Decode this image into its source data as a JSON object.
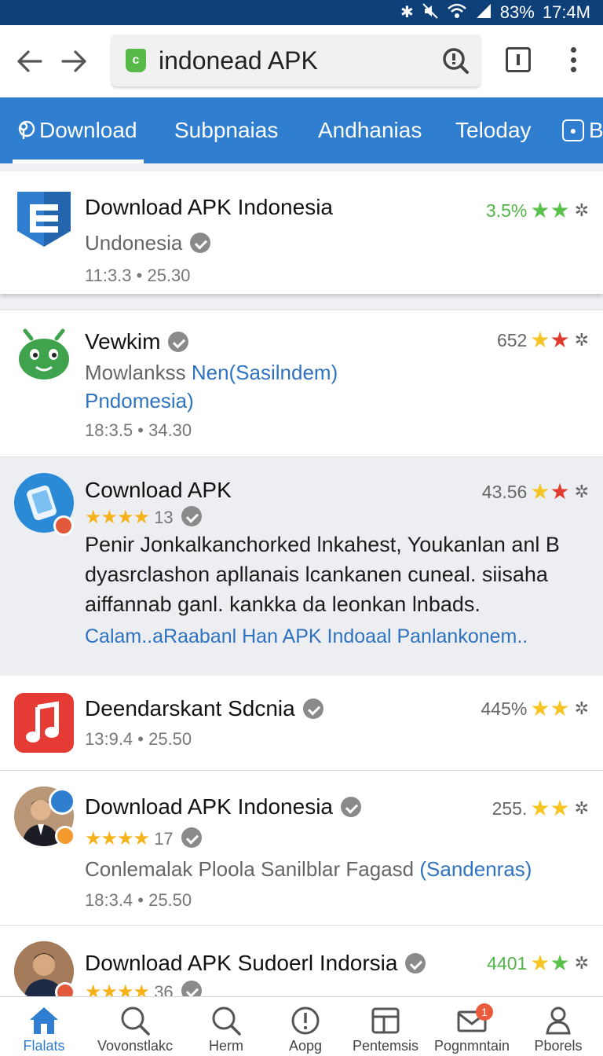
{
  "status_bar": {
    "battery": "83%",
    "time": "17:4M"
  },
  "browser": {
    "url_text": "indonead APK"
  },
  "tabs": [
    {
      "label": "Download"
    },
    {
      "label": "Subpnaias"
    },
    {
      "label": "Andhanias"
    },
    {
      "label": "Teloday"
    },
    {
      "label": "B"
    }
  ],
  "apps": [
    {
      "title": "Download APK Indonesia",
      "subtitle": "Undonesia",
      "meta": "11:3.3  •  25.30",
      "rating": "3.5%",
      "accent_color": "#52b548"
    },
    {
      "title": "Vewkim",
      "subtitle_prefix": "Mowlankss ",
      "subtitle_link": "Nen(Sasilndem)",
      "subtitle_link_line2": "Pndomesia)",
      "meta": "18:3.5  •  34.30",
      "rating": "652"
    },
    {
      "title": "Cownload APK",
      "star_count": "13",
      "rating": "43.56",
      "description": "Penir Jonkalkanchorked lnkahest, Youkanlan anl B dyasrclashon apllanais lcankanen cuneal. siisaha aiffannab ganl. kankka da leonkan lnbads.",
      "link": "Calam..aRaabanl Han APK Indoaal Panlankonem.."
    },
    {
      "title": "Deendarskant Sdcnia",
      "meta": "13:9.4  •  25.50",
      "rating": "445%"
    },
    {
      "title": "Download APK Indonesia",
      "star_count": "17",
      "subtitle_prefix": "Conlemalak Ploola Sanilblar Fagasd ",
      "subtitle_link": "(Sandenras)",
      "meta": "18:3.4  •  25.50",
      "rating": "255."
    },
    {
      "title": "Download APK Sudoerl Indorsia",
      "star_count": "36",
      "rating": "4401"
    }
  ],
  "bottom_nav": [
    {
      "label": "Flalats",
      "icon": "home-icon"
    },
    {
      "label": "Vovonstlakc",
      "icon": "search-icon"
    },
    {
      "label": "Herm",
      "icon": "search-icon"
    },
    {
      "label": "Aopg",
      "icon": "alert-icon"
    },
    {
      "label": "Pentemsis",
      "icon": "grid-icon"
    },
    {
      "label": "Pognmntain",
      "icon": "mail-icon",
      "badge": "1"
    },
    {
      "label": "Pborels",
      "icon": "profile-icon"
    }
  ],
  "colors": {
    "status_bar": "#0d3f78",
    "tab_bar": "#2f7ecf",
    "link": "#2f73c0",
    "star_green": "#59c14c",
    "star_yellow": "#f6c523",
    "star_red": "#e23b2e"
  }
}
